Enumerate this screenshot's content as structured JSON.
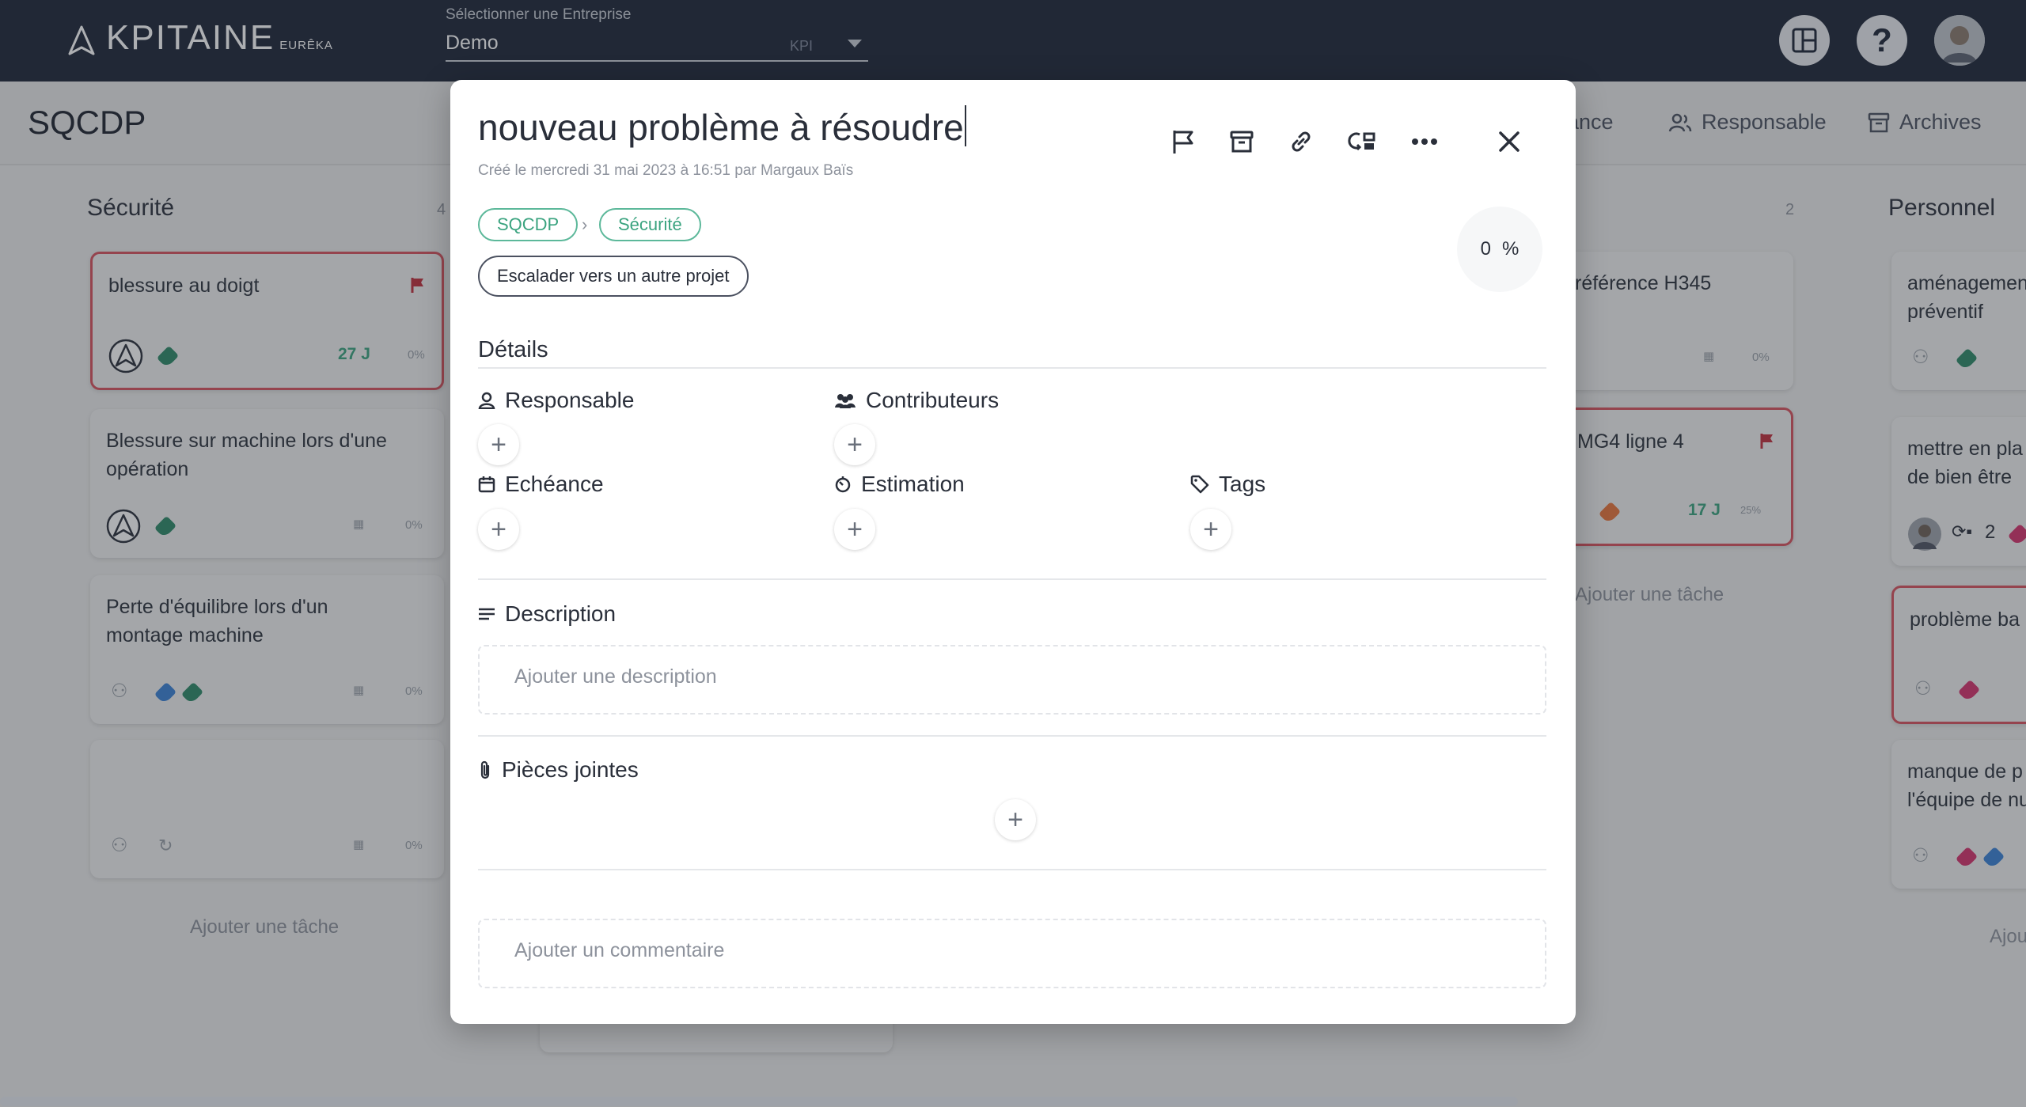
{
  "topbar": {
    "brand": "KPITAINE",
    "brand_sub": "EURÊKA",
    "company_label": "Sélectionner une Entreprise",
    "company_value": "Demo",
    "company_tag": "KPI"
  },
  "subheader": {
    "title": "SQCDP",
    "buttons": [
      {
        "label": "ance",
        "icon": "calendar-icon"
      },
      {
        "label": "Responsable",
        "icon": "users-icon"
      },
      {
        "label": "Archives",
        "icon": "archive-icon"
      }
    ]
  },
  "board": {
    "columns": [
      {
        "title": "Sécurité",
        "count": "4",
        "add_task": "Ajouter une tâche",
        "cards": [
          {
            "title": "blessure au doigt",
            "days": "27 J",
            "percent": "0%"
          },
          {
            "title": "Blessure sur machine lors d'une opération",
            "percent": "0%"
          },
          {
            "title": "Perte d'équilibre lors d'un montage machine",
            "percent": "0%"
          },
          {
            "title": "",
            "percent": "0%"
          }
        ]
      },
      {
        "title": "",
        "count": "2",
        "add_task": "Ajouter une tâche",
        "cards": [
          {
            "title": "référence H345",
            "percent": "0%"
          },
          {
            "title": "MG4 ligne 4",
            "days": "17 J",
            "percent": "25%"
          }
        ]
      },
      {
        "title": "Personnel",
        "add_task": "Ajou",
        "cards": [
          {
            "title": "aménagement préventif"
          },
          {
            "title": "mettre en pla de bien être",
            "count": "2"
          },
          {
            "title": "problème ba"
          },
          {
            "title": "manque de p l'équipe de nu"
          }
        ]
      }
    ]
  },
  "modal": {
    "title": "nouveau problème à résoudre",
    "created": "Créé le  mercredi 31 mai 2023  à  16:51  par  Margaux Baïs",
    "breadcrumbs": [
      "SQCDP",
      "Sécurité"
    ],
    "escalate_label": "Escalader vers un autre projet",
    "progress_value": "0",
    "progress_unit": "%",
    "details_title": "Détails",
    "fields": {
      "responsable": "Responsable",
      "contributeurs": "Contributeurs",
      "echeance": "Echéance",
      "estimation": "Estimation",
      "tags": "Tags"
    },
    "description_title": "Description",
    "description_placeholder": "Ajouter une description",
    "attachments_title": "Pièces jointes",
    "comment_placeholder": "Ajouter un commentaire"
  },
  "colors": {
    "topbar": "#1e2638",
    "accent_green": "#3aa37f",
    "danger_red": "#d9535e",
    "tag_green": "#2e8a68",
    "tag_blue": "#3b82d6",
    "tag_pink": "#d6336c",
    "tag_orange": "#e8743b"
  }
}
